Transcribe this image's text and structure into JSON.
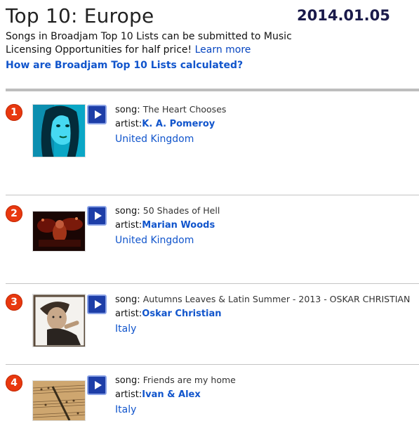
{
  "page": {
    "title": "Top 10: Europe",
    "date": "2014.01.05",
    "description": "Songs in Broadjam Top 10 Lists can be submitted to Music Licensing Opportunities for half price!",
    "learn_more": "Learn more",
    "calc_link": "How are Broadjam Top 10 Lists calculated?"
  },
  "labels": {
    "song": "song:",
    "artist": "artist:"
  },
  "entries": [
    {
      "rank": "1",
      "song": "The Heart Chooses",
      "artist": "K. A. Pomeroy",
      "country": "United Kingdom"
    },
    {
      "rank": "2",
      "song": "50 Shades of Hell",
      "artist": "Marian Woods",
      "country": "United Kingdom"
    },
    {
      "rank": "3",
      "song": "Autumns Leaves & Latin Summer - 2013 - OSKAR CHRISTIAN",
      "artist": "Oskar Christian",
      "country": "Italy"
    },
    {
      "rank": "4",
      "song": "Friends are my home",
      "artist": "Ivan & Alex",
      "country": "Italy"
    }
  ],
  "colors": {
    "rank_badge": "#e8380f",
    "link": "#1155cc",
    "play_button": "#1d3ea8",
    "rule": "#bdbdbd"
  }
}
